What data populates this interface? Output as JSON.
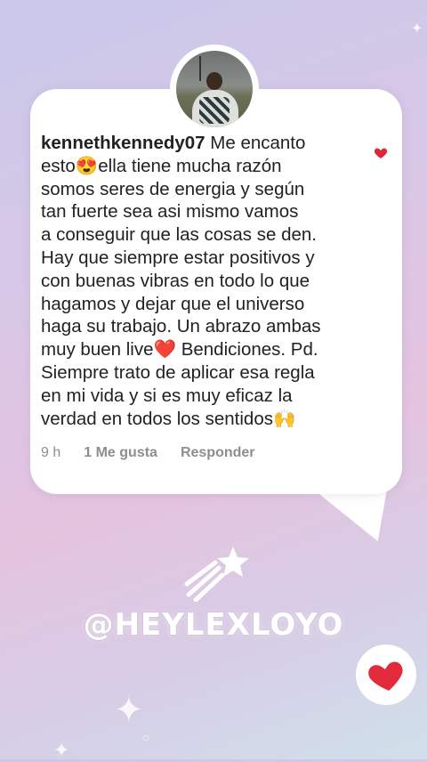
{
  "comment": {
    "username": "kennethkennedy07",
    "lines": [
      " Me encanto",
      "esto😍ella tiene mucha razón",
      "somos seres de energia y según",
      "tan fuerte sea asi mismo vamos",
      "a conseguir que las cosas se den.",
      "Hay que siempre estar positivos y",
      "con buenas vibras en todo lo que",
      "hagamos y dejar que el universo",
      "haga su trabajo. Un abrazo ambas",
      "muy buen live❤️ Bendiciones. Pd.",
      "Siempre trato de aplicar esa regla",
      "en mi vida y si es muy eficaz la",
      "verdad en todos los sentidos🙌"
    ],
    "time": "9 h",
    "likes": "1 Me gusta",
    "reply": "Responder"
  },
  "handle": "@HEYLEXLOYO",
  "colors": {
    "like_heart": "#e0243a",
    "big_heart": "#e32a3c"
  }
}
